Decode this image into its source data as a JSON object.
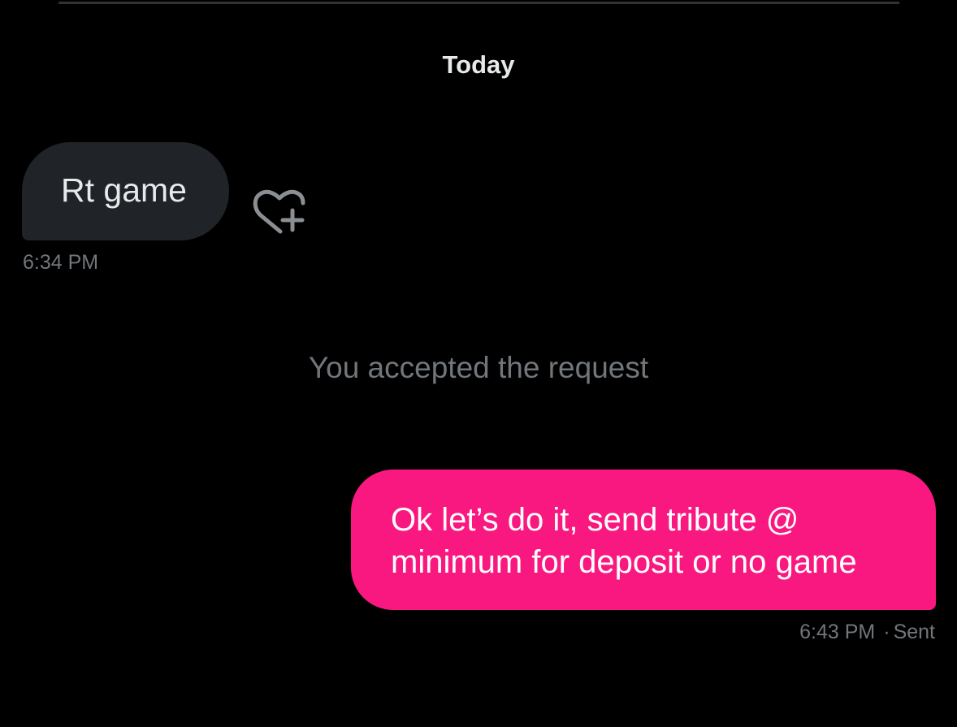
{
  "conversation": {
    "date_header": "Today",
    "messages": [
      {
        "direction": "incoming",
        "text": "Rt game",
        "time": "6:34 PM"
      },
      {
        "direction": "outgoing",
        "text": "Ok let’s do it, send tribute @ minimum for deposit or no game",
        "time": "6:43 PM",
        "separator": "·",
        "status": "Sent"
      }
    ],
    "system_message": "You accepted the request"
  },
  "icons": {
    "reaction": "heart-plus-icon"
  },
  "colors": {
    "background": "#000000",
    "incoming_bubble": "#202327",
    "outgoing_bubble": "#f91880",
    "primary_text": "#e7e9ea",
    "secondary_text": "#71767b"
  }
}
